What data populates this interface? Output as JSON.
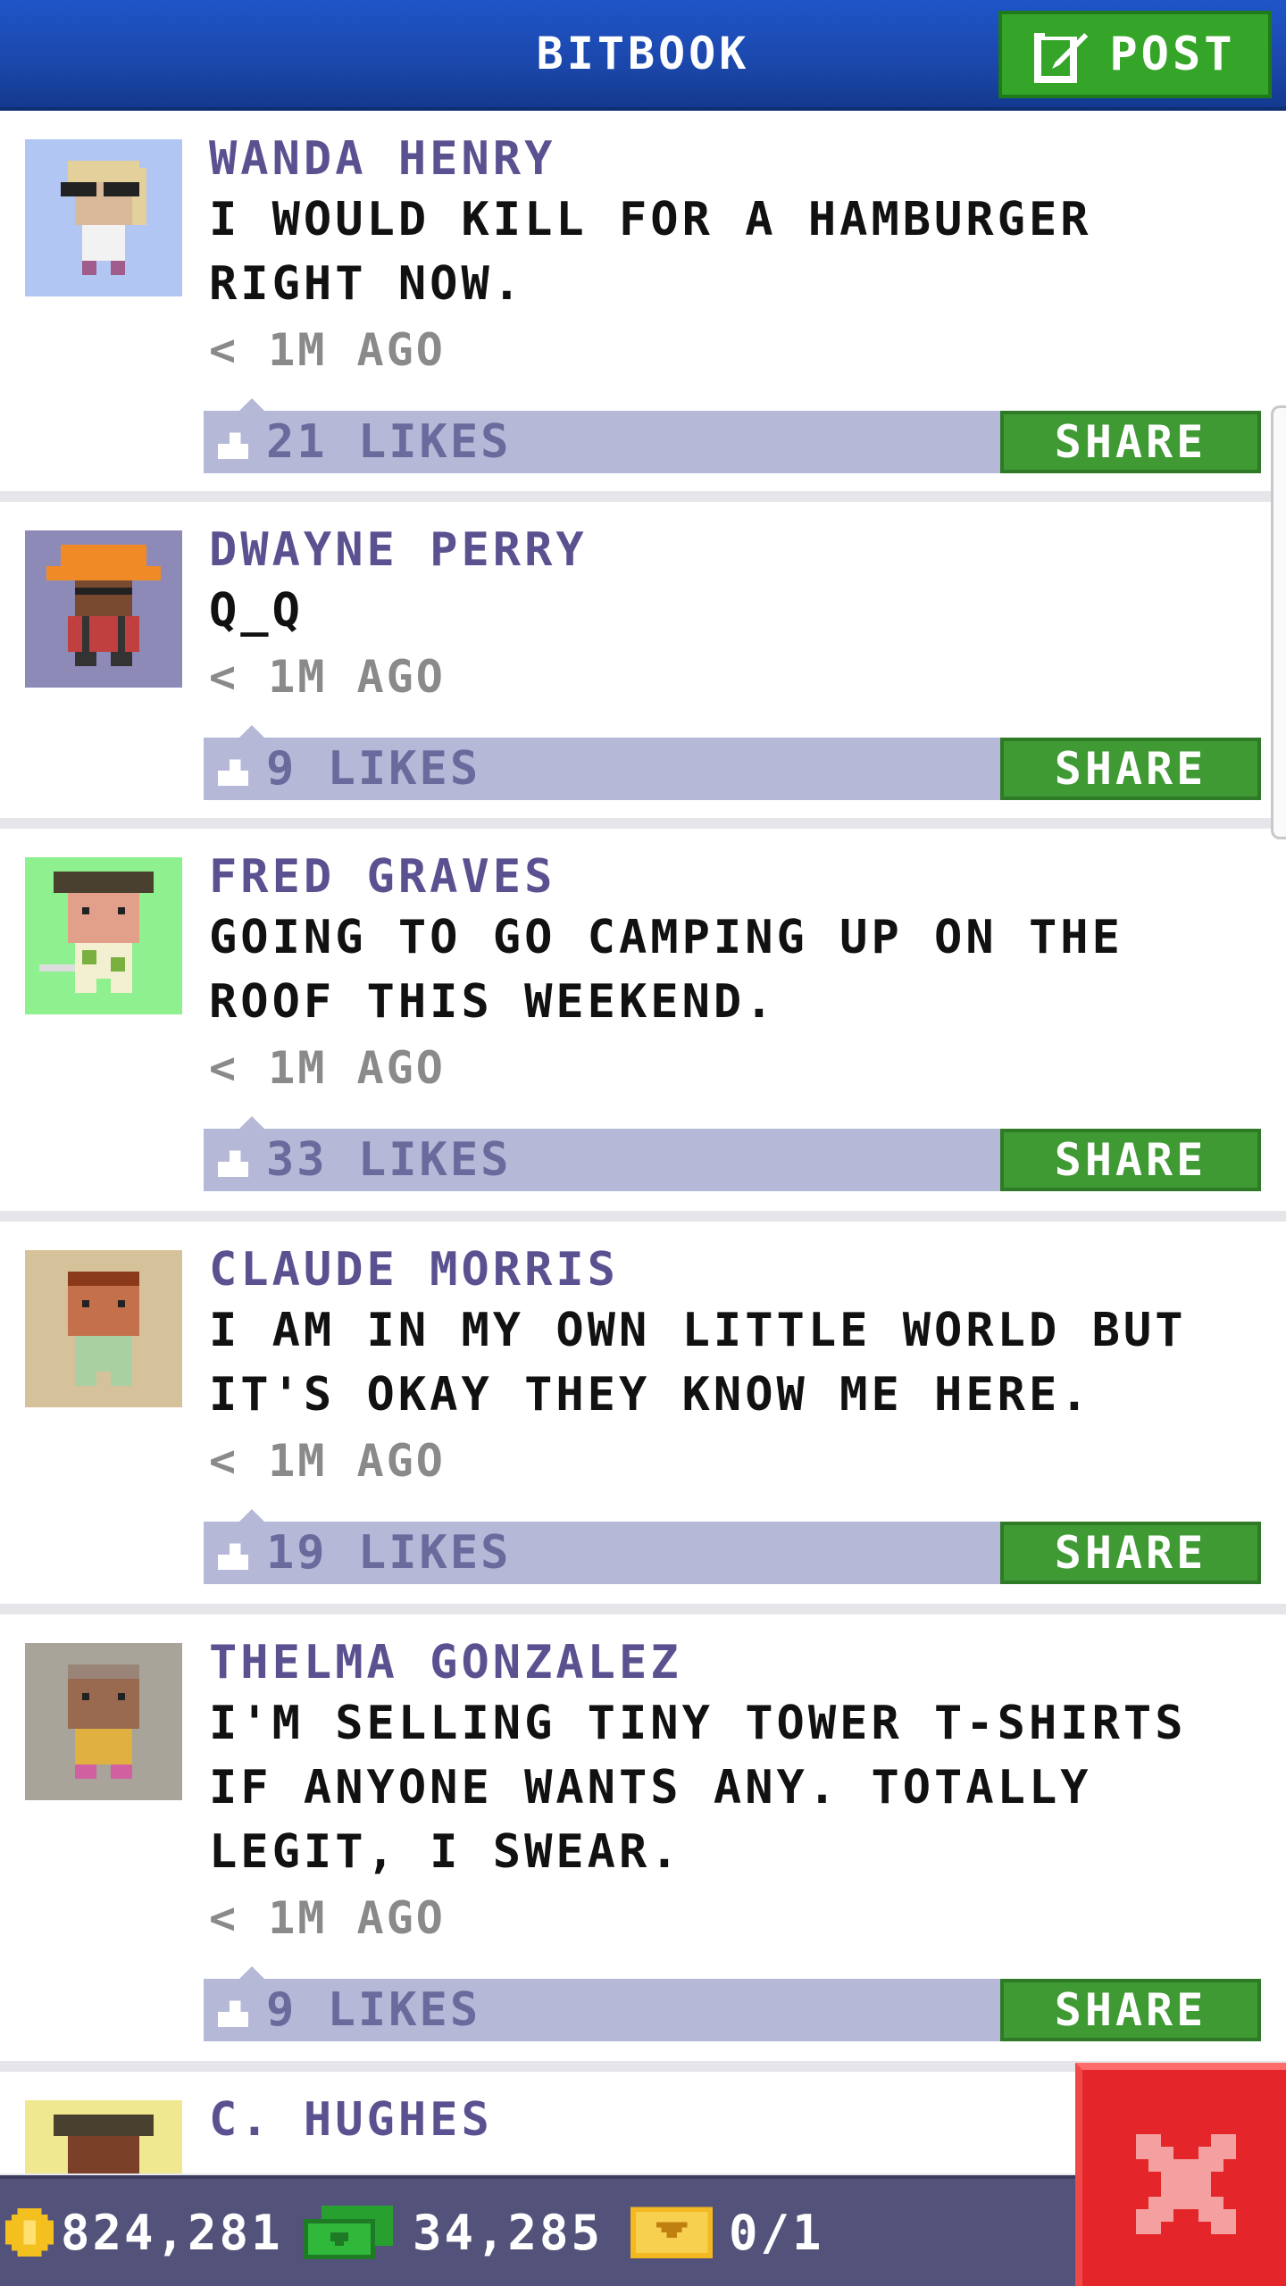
{
  "header": {
    "title": "BITBOOK",
    "post_label": "POST"
  },
  "posts": [
    {
      "author": "WANDA HENRY",
      "message": "I WOULD KILL FOR A HAMBURGER RIGHT NOW.",
      "time": "< 1M AGO",
      "likes": "21 LIKES",
      "share_label": "SHARE"
    },
    {
      "author": "DWAYNE PERRY",
      "message": "Q_Q",
      "time": "< 1M AGO",
      "likes": "9 LIKES",
      "share_label": "SHARE"
    },
    {
      "author": "FRED GRAVES",
      "message": "GOING TO GO CAMPING UP ON THE ROOF THIS WEEKEND.",
      "time": "< 1M AGO",
      "likes": "33 LIKES",
      "share_label": "SHARE"
    },
    {
      "author": "CLAUDE MORRIS",
      "message": "I AM IN MY OWN LITTLE WORLD BUT IT'S OKAY THEY KNOW ME HERE.",
      "time": "< 1M AGO",
      "likes": "19 LIKES",
      "share_label": "SHARE"
    },
    {
      "author": "THELMA GONZALEZ",
      "message": "I'M SELLING TINY TOWER T-SHIRTS IF ANYONE WANTS ANY. TOTALLY LEGIT, I SWEAR.",
      "time": "< 1M AGO",
      "likes": "9 LIKES",
      "share_label": "SHARE"
    },
    {
      "author": "C. HUGHES",
      "message": "",
      "time": "",
      "likes": "",
      "share_label": ""
    }
  ],
  "status": {
    "coins": "824,281",
    "bux": "34,285",
    "tickets": "0/1"
  },
  "colors": {
    "header": "#1b47ab",
    "post_button": "#35a52a",
    "share_button": "#3f9a33",
    "like_bar": "#b6b8d8",
    "author": "#5a5290",
    "status_bar": "#52527a",
    "close_button": "#e4262a"
  },
  "icons": {
    "post": "edit-icon",
    "like": "thumb-up-icon",
    "coin": "coin-icon",
    "bux": "bux-icon",
    "ticket": "vip-ticket-icon",
    "close": "close-icon"
  }
}
